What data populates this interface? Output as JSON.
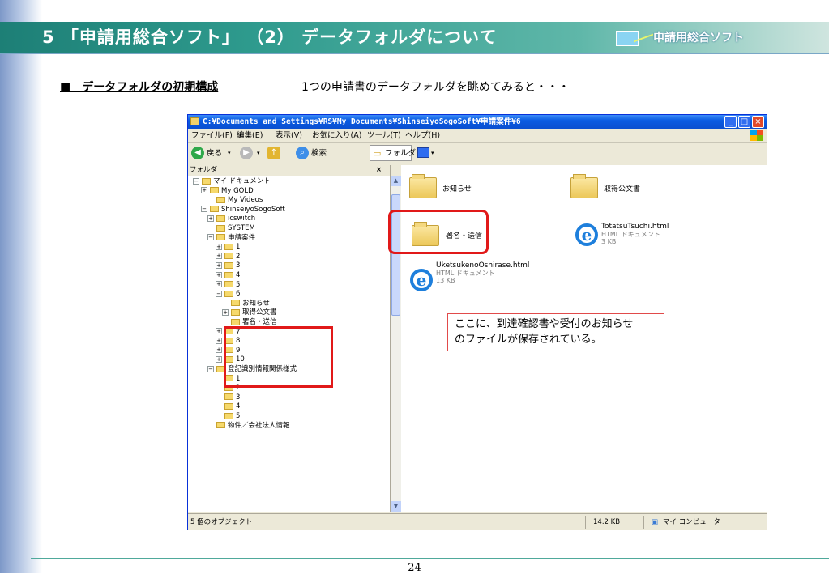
{
  "slide": {
    "title": "5 「申請用総合ソフト」 （2） データフォルダについて",
    "logo_text": "申請用総合ソフト",
    "heading": "■　データフォルダの初期構成",
    "heading_desc": "1つの申請書のデータフォルダを眺めてみると・・・",
    "callout_line1": "ここに、到達確認書や受付のお知らせ",
    "callout_line2": "のファイルが保存されている。",
    "page_number": "24"
  },
  "window": {
    "title": "C:¥Documents and Settings¥RS¥My Documents¥ShinseiyoSogoSoft¥申請案件¥6",
    "controls": [
      "_",
      "□",
      "×"
    ],
    "menu": [
      "ファイル(F)",
      "編集(E)",
      "表示(V)",
      "お気に入り(A)",
      "ツール(T)",
      "ヘルプ(H)"
    ],
    "toolbar": {
      "back": "戻る",
      "search": "検索",
      "folders": "フォルダ"
    },
    "folders_pane": {
      "header": "フォルダ",
      "close": "×",
      "tree": [
        {
          "label": "マイ ドキュメント",
          "pm": "⊟"
        },
        {
          "label": "My GOLD",
          "pm": "⊞"
        },
        {
          "label": "My Videos",
          "pm": ""
        },
        {
          "label": "ShinseiyoSogoSoft",
          "pm": "⊟"
        },
        {
          "label": "icswitch",
          "pm": "⊞"
        },
        {
          "label": "SYSTEM",
          "pm": ""
        },
        {
          "label": "申請案件",
          "pm": "⊟"
        },
        {
          "label": "1",
          "pm": "⊞"
        },
        {
          "label": "2",
          "pm": "⊞"
        },
        {
          "label": "3",
          "pm": "⊞"
        },
        {
          "label": "4",
          "pm": "⊞"
        },
        {
          "label": "5",
          "pm": "⊞"
        },
        {
          "label": "6",
          "pm": "⊟"
        },
        {
          "label": "お知らせ",
          "pm": ""
        },
        {
          "label": "取得公文書",
          "pm": "⊞"
        },
        {
          "label": "署名・送信",
          "pm": ""
        },
        {
          "label": "7",
          "pm": "⊞"
        },
        {
          "label": "8",
          "pm": "⊞"
        },
        {
          "label": "9",
          "pm": "⊞"
        },
        {
          "label": "10",
          "pm": "⊞"
        },
        {
          "label": "登記識別情報関係様式",
          "pm": "⊟"
        },
        {
          "label": "1",
          "pm": ""
        },
        {
          "label": "2",
          "pm": ""
        },
        {
          "label": "3",
          "pm": ""
        },
        {
          "label": "4",
          "pm": ""
        },
        {
          "label": "5",
          "pm": ""
        },
        {
          "label": "物件／会社法人情報",
          "pm": ""
        }
      ]
    },
    "files": [
      {
        "name": "お知らせ",
        "icon": "folder-icon"
      },
      {
        "name": "取得公文書",
        "icon": "folder-icon"
      },
      {
        "name": "署名・送信",
        "icon": "folder-icon"
      },
      {
        "name": "TotatsuTsuchi.html",
        "type": "HTML ドキュメント",
        "size": "3 KB",
        "icon": "ie-icon"
      },
      {
        "name": "UketsukenoOshirase.html",
        "type": "HTML ドキュメント",
        "size": "13 KB",
        "icon": "ie-icon"
      }
    ],
    "status": {
      "objects": "5 個のオブジェクト",
      "size": "14.2 KB",
      "location": "マイ コンピューター"
    }
  },
  "colors": {
    "title_bar": "#1d7f76",
    "highlight_red": "#e11919",
    "xp_blue": "#0a5be2"
  }
}
